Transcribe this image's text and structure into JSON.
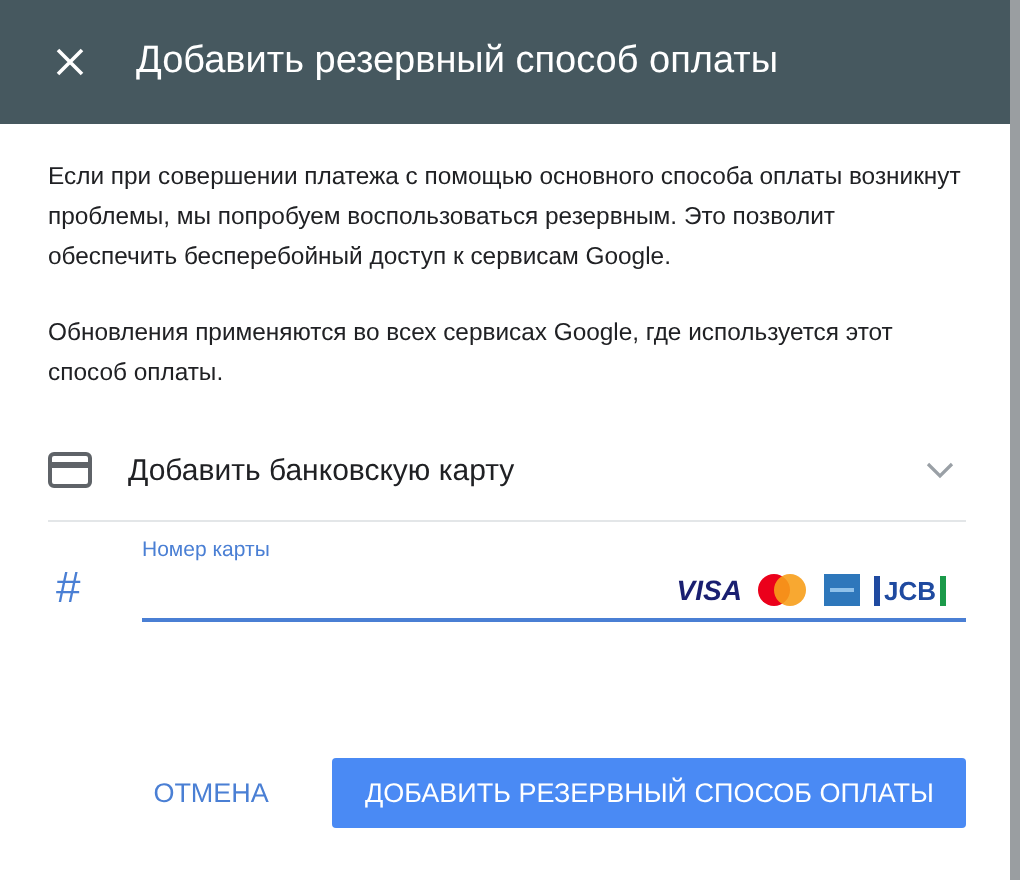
{
  "dialog": {
    "title": "Добавить резервный способ оплаты",
    "paragraphs": [
      "Если при совершении платежа с помощью основного способа оплаты возникнут проблемы, мы попробуем воспользоваться резервным. Это позволит обеспечить бесперебойный доступ к сервисам Google.",
      "Обновления применяются во всех сервисах Google, где используется этот способ оплаты."
    ],
    "method_dropdown": {
      "label": "Добавить банковскую карту",
      "expanded": false
    },
    "card_field": {
      "prefix": "#",
      "placeholder": "Номер карты",
      "focused": true,
      "brands": [
        {
          "kind": "visa",
          "label": "VISA"
        },
        {
          "kind": "mastercard"
        },
        {
          "kind": "amex"
        },
        {
          "kind": "jcb",
          "label": "JCB"
        }
      ]
    },
    "buttons": [
      {
        "label": "ОТМЕНА",
        "kind": "text"
      },
      {
        "label": "ДОБАВИТЬ РЕЗЕРВНЫЙ СПОСОБ ОПЛАТЫ",
        "kind": "primary"
      }
    ]
  }
}
